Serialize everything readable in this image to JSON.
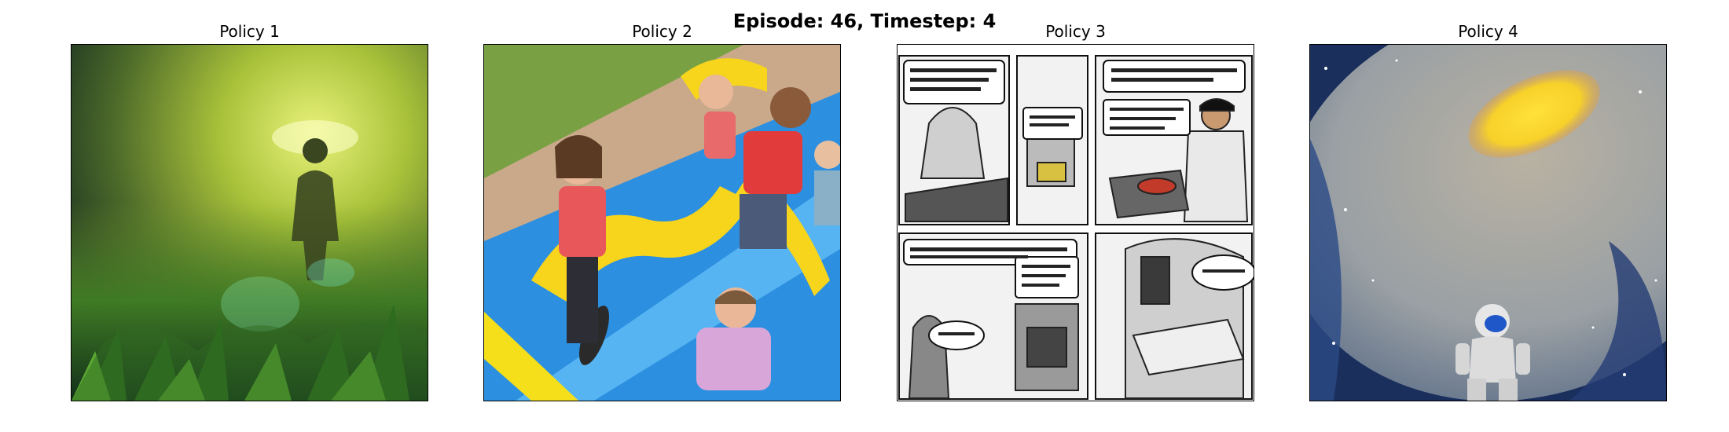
{
  "figure": {
    "suptitle": "Episode: 46, Timestep: 4"
  },
  "panels": [
    {
      "title": "Policy 1",
      "image": "green-foggy-figure-in-plants"
    },
    {
      "title": "Policy 2",
      "image": "children-on-bouncy-slide"
    },
    {
      "title": "Policy 3",
      "image": "black-and-white-comic-page"
    },
    {
      "title": "Policy 4",
      "image": "astronaut-in-galaxy"
    }
  ],
  "colors": {
    "background": "#ffffff",
    "text": "#000000",
    "frame": "#000000"
  }
}
